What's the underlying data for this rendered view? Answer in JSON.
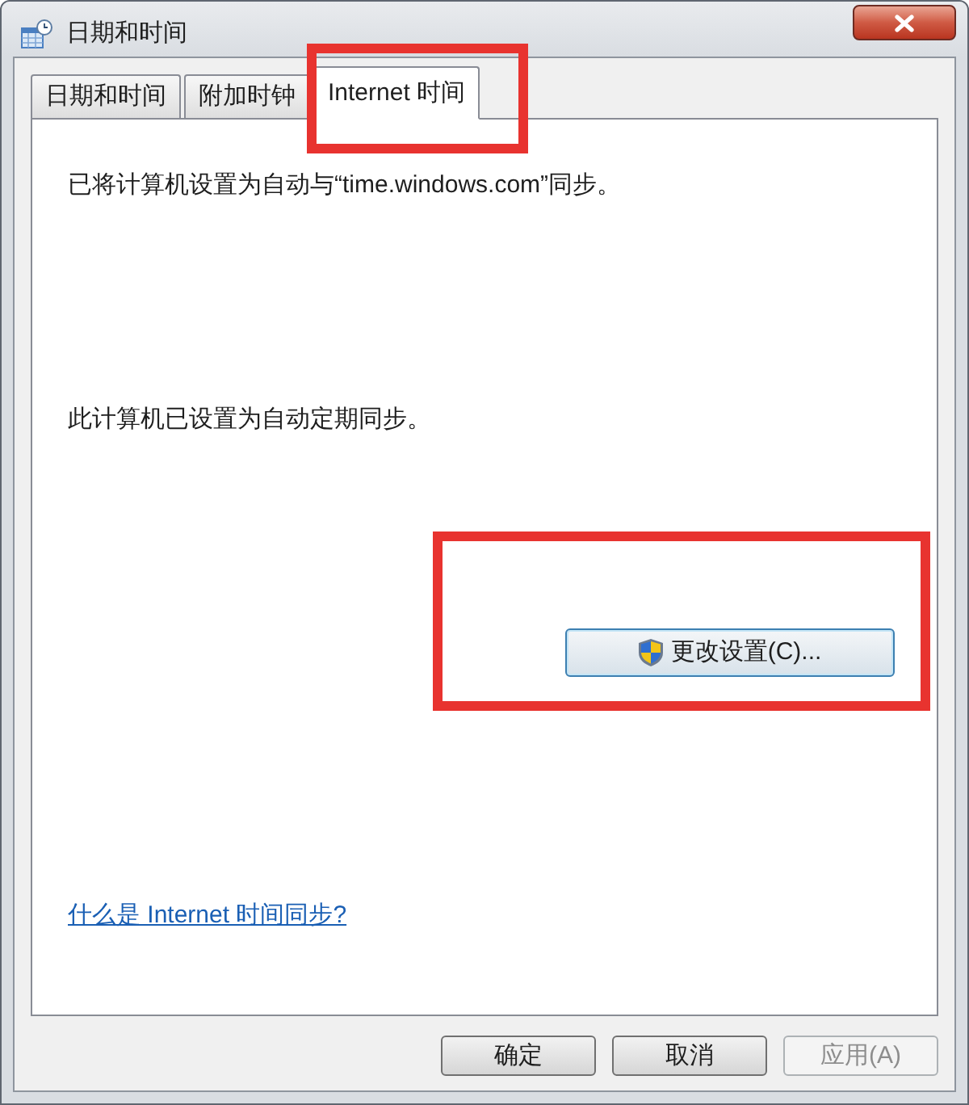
{
  "window": {
    "title": "日期和时间"
  },
  "tabs": [
    {
      "label": "日期和时间",
      "selected": false,
      "highlighted": false
    },
    {
      "label": "附加时钟",
      "selected": false,
      "highlighted": false
    },
    {
      "label": "Internet 时间",
      "selected": true,
      "highlighted": true
    }
  ],
  "panel": {
    "sync_status": "已将计算机设置为自动与“time.windows.com”同步。",
    "schedule_status": "此计算机已设置为自动定期同步。",
    "change_button": {
      "label": "更改设置(C)...",
      "highlighted": true
    },
    "help_link": "什么是 Internet 时间同步?"
  },
  "buttons": [
    {
      "label": "确定",
      "disabled": false
    },
    {
      "label": "取消",
      "disabled": false
    },
    {
      "label": "应用(A)",
      "disabled": true
    }
  ]
}
